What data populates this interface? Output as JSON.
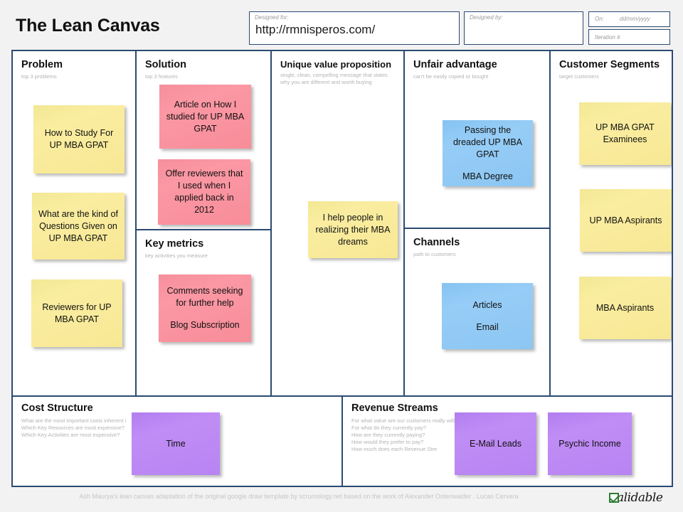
{
  "header": {
    "title": "The Lean Canvas",
    "designed_for": {
      "label": "Designed for:",
      "value": "http://rmnisperos.com/"
    },
    "designed_by": {
      "label": "Designed by:",
      "value": ""
    },
    "on": {
      "label": "On:",
      "placeholder": "dd/mm/yyyy"
    },
    "iteration": {
      "label": "Iteration #"
    }
  },
  "cells": {
    "problem": {
      "title": "Problem",
      "hint": "top 3 problems",
      "notes": [
        {
          "text": "How to Study For UP MBA GPAT",
          "color": "yellow"
        },
        {
          "text": "What are the kind of Questions Given on UP MBA GPAT",
          "color": "yellow"
        },
        {
          "text": "Reviewers for UP MBA GPAT",
          "color": "yellow"
        }
      ]
    },
    "solution": {
      "title": "Solution",
      "hint": "top 3 features",
      "notes": [
        {
          "text": "Article on How I studied for UP MBA GPAT",
          "color": "pink"
        },
        {
          "text": "Offer reviewers that I used when I applied back in 2012",
          "color": "pink"
        }
      ]
    },
    "key_metrics": {
      "title": "Key metrics",
      "hint": "key activities you measure",
      "notes": [
        {
          "text": "Comments seeking for further help",
          "text2": "Blog Subscription",
          "color": "pink"
        }
      ]
    },
    "uvp": {
      "title": "Unique value proposition",
      "hint": "single, clean, compelling message that states\nwhy you are different and worth buying",
      "notes": [
        {
          "text": "I help people in realizing their MBA dreams",
          "color": "yellow"
        }
      ]
    },
    "unfair_advantage": {
      "title": "Unfair advantage",
      "hint": "can't be easily copied or bought",
      "notes": [
        {
          "text": "Passing the dreaded UP MBA GPAT",
          "text2": "MBA Degree",
          "color": "blue"
        }
      ]
    },
    "channels": {
      "title": "Channels",
      "hint": "path to customers",
      "notes": [
        {
          "text": "Articles",
          "text2": "Email",
          "color": "blue"
        }
      ]
    },
    "customer_segments": {
      "title": "Customer Segments",
      "hint": "target customers",
      "notes": [
        {
          "text": "UP MBA GPAT Examinees",
          "color": "yellow"
        },
        {
          "text": "UP MBA Aspirants",
          "color": "yellow"
        },
        {
          "text": "MBA Aspirants",
          "color": "yellow"
        }
      ]
    },
    "cost_structure": {
      "title": "Cost Structure",
      "hint": "What are the most important costs inherent i\nWhich Key Resources are most expensive?\nWhich Key Activities are most expensive?",
      "notes": [
        {
          "text": "Time",
          "color": "purple"
        }
      ]
    },
    "revenue_streams": {
      "title": "Revenue Streams",
      "hint": "For what value are our customers really willing to pay?\nFor what do they currently pay?\nHow are they currently paying?\nHow would they prefer to pay?\nHow much does each Revenue Stre",
      "notes": [
        {
          "text": "E-Mail Leads",
          "color": "purple"
        },
        {
          "text": "Psychic Income",
          "color": "purple"
        }
      ]
    }
  },
  "footer": {
    "credit": "Ash Maurya's lean canvas adaptation of the original google draw template by scrumology.net based on the work of Alexander Ostenwalder . Lucas Cervera",
    "logo_word": "alidable"
  },
  "colors": {
    "border": "#2b4a72",
    "background": "#f2f2f2",
    "note_yellow": "#f7e894",
    "note_pink": "#f78d99",
    "note_blue": "#8cc6f2",
    "note_purple": "#b884f2",
    "hint_text": "#b3b3b3"
  }
}
